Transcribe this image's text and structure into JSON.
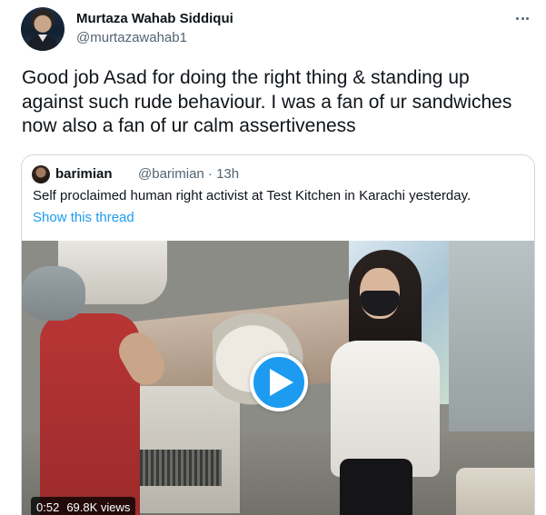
{
  "author": {
    "name": "Murtaza Wahab Siddiqui",
    "handle": "@murtazawahab1"
  },
  "tweet": {
    "text": "Good job Asad for doing the right thing & standing up against such rude behaviour. I was a fan of ur sandwiches now also a fan of ur calm assertiveness"
  },
  "quoted_tweet": {
    "name": "barimian",
    "handle_time": "@barimian · 13h",
    "text": "Self proclaimed human right activist at Test Kitchen in Karachi yesterday.",
    "show_thread": "Show this thread",
    "video": {
      "duration": "0:52",
      "views": "69.8K views"
    }
  },
  "colors": {
    "accent": "#1d9bf0",
    "text_primary": "#0f1419",
    "text_secondary": "#536471",
    "border": "#cfd9de"
  },
  "icons": {
    "more": "more-horizontal-icon",
    "play": "play-icon"
  }
}
